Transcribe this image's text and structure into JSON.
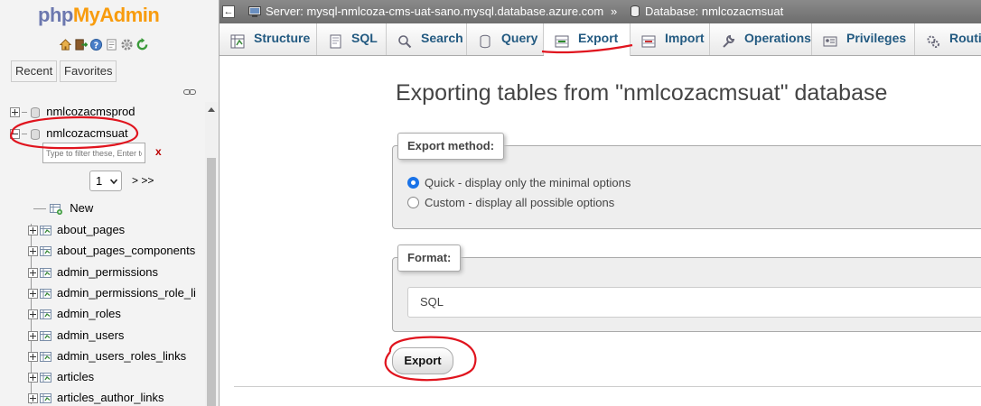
{
  "app": {
    "logo_php": "php",
    "logo_admin": "MyAdmin"
  },
  "nav": {
    "tabs": {
      "recent": "Recent",
      "favorites": "Favorites"
    },
    "databases": [
      {
        "name": "nmlcozacmsprod",
        "state": "collapsed"
      },
      {
        "name": "nmlcozacmsuat",
        "state": "expanded"
      }
    ],
    "filter": {
      "placeholder": "Type to filter these, Enter to search all",
      "clear_label": "x"
    },
    "pagination": {
      "selected_page": "1",
      "next_label": "> >>"
    },
    "new_label": "New",
    "tables": [
      "about_pages",
      "about_pages_components",
      "admin_permissions",
      "admin_permissions_role_li",
      "admin_roles",
      "admin_users",
      "admin_users_roles_links",
      "articles",
      "articles_author_links"
    ]
  },
  "breadcrumb": {
    "server_label": "Server: mysql-nmlcoza-cms-uat-sano.mysql.database.azure.com",
    "separator": "»",
    "database_label": "Database: nmlcozacmsuat"
  },
  "menu": {
    "tabs": [
      {
        "label": "Structure",
        "icon": "structure-icon"
      },
      {
        "label": "SQL",
        "icon": "sql-icon"
      },
      {
        "label": "Search",
        "icon": "search-icon"
      },
      {
        "label": "Query",
        "icon": "query-icon"
      },
      {
        "label": "Export",
        "icon": "export-icon",
        "active": true
      },
      {
        "label": "Import",
        "icon": "import-icon"
      },
      {
        "label": "Operations",
        "icon": "wrench-icon"
      },
      {
        "label": "Privileges",
        "icon": "privileges-icon"
      },
      {
        "label": "Routi",
        "icon": "routines-icon"
      }
    ]
  },
  "main": {
    "title": "Exporting tables from \"nmlcozacmsuat\" database",
    "export_method": {
      "legend": "Export method:",
      "options": [
        {
          "label": "Quick - display only the minimal options",
          "checked": true
        },
        {
          "label": "Custom - display all possible options",
          "checked": false
        }
      ]
    },
    "format": {
      "legend": "Format:",
      "selected": "SQL"
    },
    "export_button": "Export"
  },
  "colors": {
    "link_blue": "#235a81",
    "annotation_red": "#e0141e",
    "logo_blue": "#6c78af",
    "logo_orange": "#f89c0e"
  }
}
